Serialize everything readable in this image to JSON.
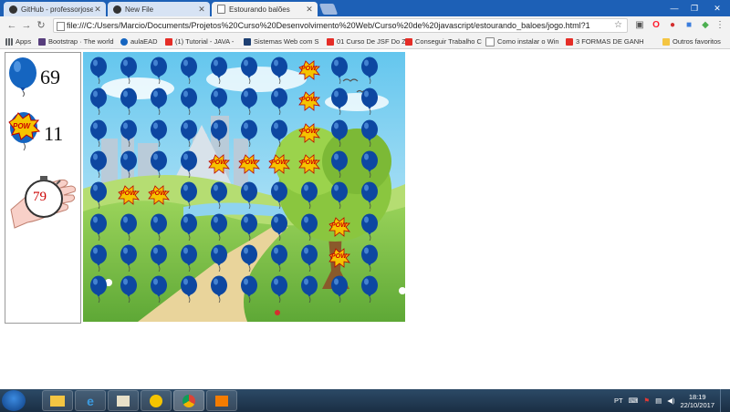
{
  "browser": {
    "tabs": [
      {
        "label": "GitHub - professorjosedi",
        "icon": "github-icon",
        "active": false
      },
      {
        "label": "New File",
        "icon": "github-icon",
        "active": false
      },
      {
        "label": "Estourando balões",
        "icon": "page-icon",
        "active": true
      }
    ],
    "address": "file:///C:/Users/Marcio/Documents/Projetos%20Curso%20Desenvolvimento%20Web/Curso%20de%20javascript/estourando_baloes/jogo.html?1",
    "bookmarks": [
      {
        "label": "Apps",
        "color": "#5f6368"
      },
      {
        "label": "Bootstrap · The world",
        "color": "#563d7c"
      },
      {
        "label": "aulaEAD",
        "color": "#1565c0"
      },
      {
        "label": "(1) Tutorial - JAVA - ",
        "color": "#e52d27"
      },
      {
        "label": "Sistemas Web com S",
        "color": "#1d3f72"
      },
      {
        "label": "01 Curso De JSF Do Z",
        "color": "#e52d27"
      },
      {
        "label": "Conseguir Trabalho C",
        "color": "#e52d27"
      },
      {
        "label": "Como instalar o Win",
        "color": "#666666"
      },
      {
        "label": "3 FORMAS DE GANH",
        "color": "#e52d27"
      }
    ],
    "other_bookmarks": "Outros favoritos"
  },
  "game": {
    "balloons_remaining": "69",
    "balloons_popped": "11",
    "timer_seconds": "79",
    "pop_label": "POW",
    "colors": {
      "balloon": "#0d47a1",
      "pow": "#f5c400",
      "timer": "#cc0000"
    }
  },
  "taskbar": {
    "language": "PT",
    "time": "18:19",
    "date": "22/10/2017"
  }
}
